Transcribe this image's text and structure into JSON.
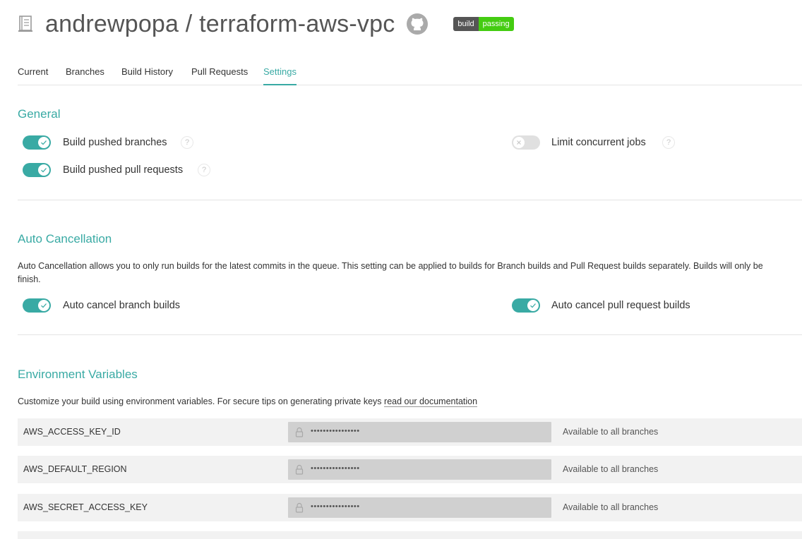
{
  "header": {
    "repo_title": "andrewpopa / terraform-aws-vpc",
    "badge_left": "build",
    "badge_right": "passing"
  },
  "tabs": [
    {
      "label": "Current",
      "active": false
    },
    {
      "label": "Branches",
      "active": false
    },
    {
      "label": "Build History",
      "active": false
    },
    {
      "label": "Pull Requests",
      "active": false
    },
    {
      "label": "Settings",
      "active": true
    }
  ],
  "general": {
    "title": "General",
    "options": [
      {
        "label": "Build pushed branches",
        "enabled": true,
        "help": "?"
      },
      {
        "label": "Build pushed pull requests",
        "enabled": true,
        "help": "?"
      },
      {
        "label": "Limit concurrent jobs",
        "enabled": false,
        "help": "?"
      }
    ]
  },
  "auto_cancellation": {
    "title": "Auto Cancellation",
    "description_line1": "Auto Cancellation allows you to only run builds for the latest commits in the queue. This setting can be applied to builds for Branch builds and Pull Request builds separately. Builds will only be",
    "description_line2": "finish.",
    "options": [
      {
        "label": "Auto cancel branch builds",
        "enabled": true
      },
      {
        "label": "Auto cancel pull request builds",
        "enabled": true
      }
    ]
  },
  "env_vars": {
    "title": "Environment Variables",
    "description": "Customize your build using environment variables. For secure tips on generating private keys",
    "doc_link": "read our documentation",
    "rows": [
      {
        "name": "AWS_ACCESS_KEY_ID",
        "value": "••••••••••••••••",
        "branches": "Available to all branches"
      },
      {
        "name": "AWS_DEFAULT_REGION",
        "value": "••••••••••••••••",
        "branches": "Available to all branches"
      },
      {
        "name": "AWS_SECRET_ACCESS_KEY",
        "value": "••••••••••••••••",
        "branches": "Available to all branches"
      }
    ]
  },
  "colors": {
    "accent": "#39aaa4",
    "badge_pass": "#44cc11",
    "row_bg": "#f2f2f2"
  },
  "icons": {
    "repo": "repo-icon",
    "github": "github-icon",
    "check": "check-icon",
    "x": "x-icon",
    "lock": "lock-icon",
    "help": "help-icon"
  }
}
